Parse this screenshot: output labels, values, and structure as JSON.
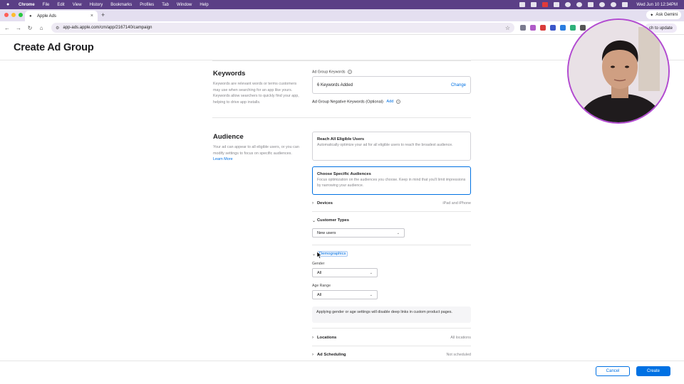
{
  "menubar": {
    "app": "Chrome",
    "items": [
      "File",
      "Edit",
      "View",
      "History",
      "Bookmarks",
      "Profiles",
      "Tab",
      "Window",
      "Help"
    ],
    "clock": "Wed Jun 10  12:34PM"
  },
  "browser": {
    "tab_title": "Apple Ads",
    "url": "app-ads.apple.com/cm/app/2167140/campaign",
    "ask_gemini": "Ask Gemini",
    "update_label": "ch to update"
  },
  "page": {
    "title": "Create Ad Group"
  },
  "keywords": {
    "title": "Keywords",
    "description": "Keywords are relevant words or terms customers may use when searching for an app like yours. Keywords allow searchers to quickly find your app, helping to drive app installs.",
    "field_label": "Ad Group Keywords",
    "count_text": "6 Keywords Added",
    "change_label": "Change",
    "negative_label": "Ad Group Negative Keywords (Optional)",
    "negative_add": "Add"
  },
  "audience": {
    "title": "Audience",
    "description": "Your ad can appear to all eligible users, or you can modify settings to focus on specific audiences.",
    "learn_more": "Learn More",
    "option_all": {
      "title": "Reach All Eligible Users",
      "desc": "Automatically optimize your ad for all eligible users to reach the broadest audience."
    },
    "option_specific": {
      "title": "Choose Specific Audiences",
      "desc": "Focus optimization on the audiences you choose. Keep in mind that you'll limit impressions by narrowing your audience."
    },
    "devices": {
      "label": "Devices",
      "value": "iPad and iPhone"
    },
    "customer_types": {
      "label": "Customer Types",
      "selected": "New users"
    },
    "demographics": {
      "label": "Demographics",
      "gender_label": "Gender",
      "gender_value": "All",
      "age_label": "Age Range",
      "age_value": "All",
      "notice": "Applying gender or age settings will disable deep links in custom product pages."
    },
    "locations": {
      "label": "Locations",
      "value": "All locations"
    },
    "ad_scheduling": {
      "label": "Ad Scheduling",
      "value": "Not scheduled"
    }
  },
  "footer": {
    "cancel": "Cancel",
    "create": "Create"
  },
  "colors": {
    "accent": "#0071e3",
    "menubar": "#5b3f86",
    "webcam_ring": "#b24ad1"
  }
}
